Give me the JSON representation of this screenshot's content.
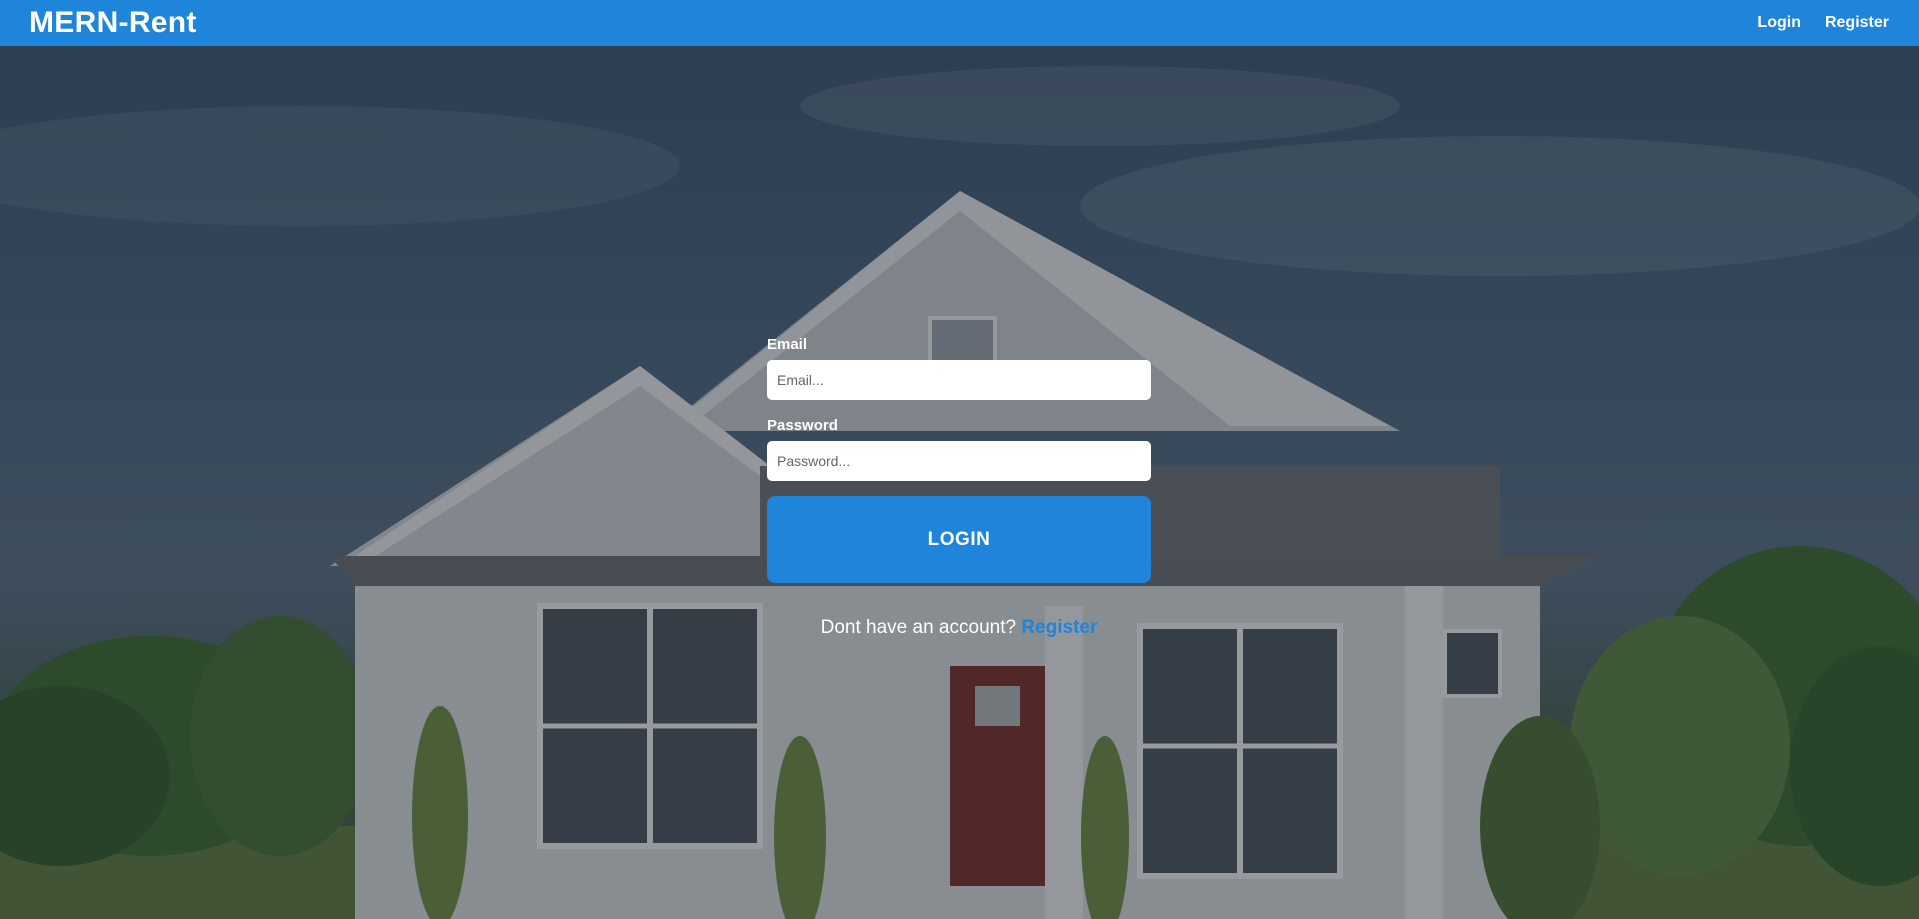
{
  "navbar": {
    "brand": "MERN-Rent",
    "links": [
      {
        "label": "Login"
      },
      {
        "label": "Register"
      }
    ]
  },
  "login_form": {
    "email_label": "Email",
    "email_placeholder": "Email...",
    "password_label": "Password",
    "password_placeholder": "Password...",
    "submit_label": "LOGIN",
    "signup_prompt": "Dont have an account?",
    "signup_link": "Register"
  },
  "colors": {
    "primary": "#1e85db",
    "text_light": "#ffffff"
  }
}
